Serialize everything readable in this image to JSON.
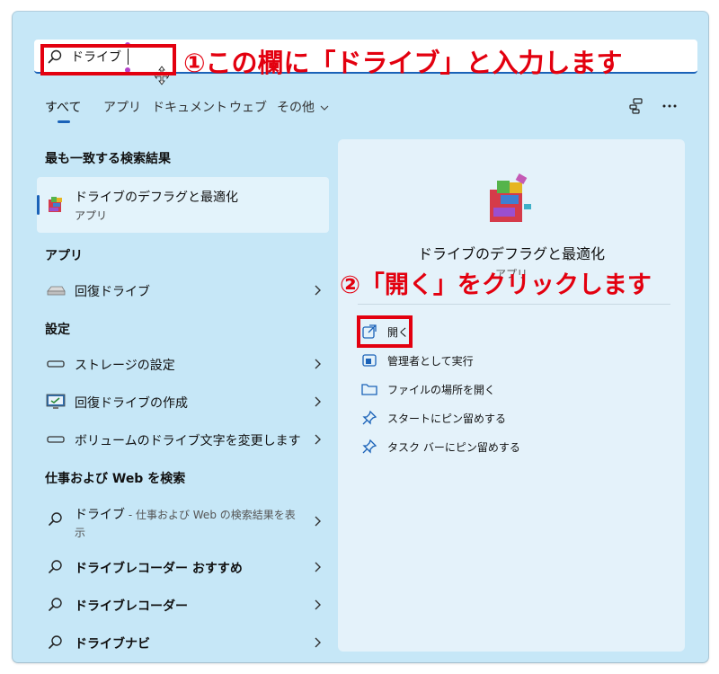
{
  "search": {
    "query": "ドライブ"
  },
  "annotations": {
    "step1": "①この欄に「ドライブ」と入力します",
    "step2": "②「開く」をクリックします"
  },
  "tabs": [
    {
      "label": "すべて",
      "active": true
    },
    {
      "label": "アプリ",
      "active": false
    },
    {
      "label": "ドキュメント",
      "active": false
    },
    {
      "label": "ウェブ",
      "active": false
    },
    {
      "label": "その他",
      "active": false
    }
  ],
  "left": {
    "best_match_heading": "最も一致する検索結果",
    "best_match": {
      "title": "ドライブのデフラグと最適化",
      "subtitle": "アプリ"
    },
    "apps_heading": "アプリ",
    "apps": [
      {
        "label": "回復ドライブ"
      }
    ],
    "settings_heading": "設定",
    "settings": [
      {
        "label": "ストレージの設定"
      },
      {
        "label": "回復ドライブの作成"
      },
      {
        "label": "ボリュームのドライブ文字を変更します"
      }
    ],
    "web_heading": "仕事および Web を検索",
    "web": [
      {
        "label": "ドライブ",
        "suffix": " - 仕事および Web の検索結果を表",
        "line2": "示"
      },
      {
        "label": "ドライブレコーダー おすすめ"
      },
      {
        "label": "ドライブレコーダー"
      },
      {
        "label": "ドライブナビ"
      }
    ]
  },
  "right": {
    "app_title": "ドライブのデフラグと最適化",
    "app_subtitle": "アプリ",
    "actions": [
      {
        "label": "開く",
        "icon": "open-external-icon"
      },
      {
        "label": "管理者として実行",
        "icon": "shield-admin-icon"
      },
      {
        "label": "ファイルの場所を開く",
        "icon": "folder-icon"
      },
      {
        "label": "スタートにピン留めする",
        "icon": "pin-icon"
      },
      {
        "label": "タスク バーにピン留めする",
        "icon": "pin-icon"
      }
    ]
  },
  "colors": {
    "panel_bg": "#c6e7f7",
    "accent": "#1a62b8",
    "annotation_red": "#e3000f"
  }
}
